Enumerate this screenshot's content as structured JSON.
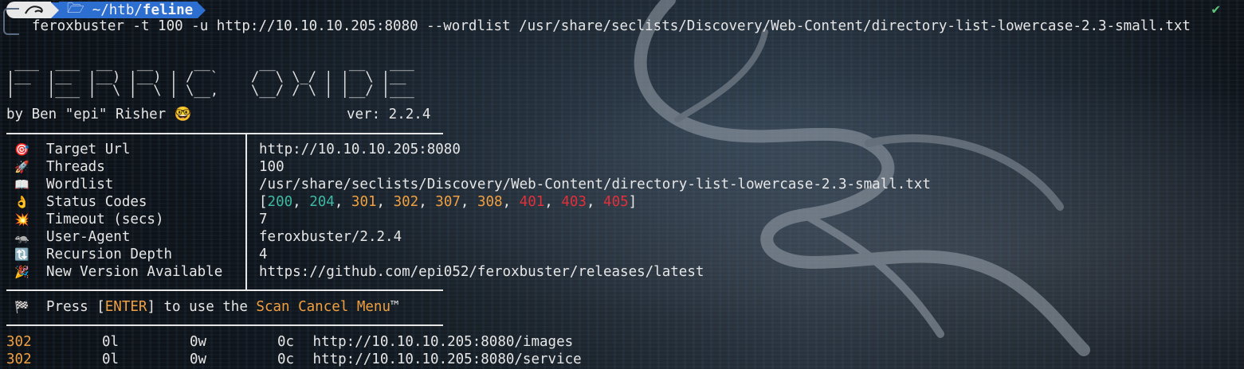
{
  "prompt": {
    "user_icon": "kali-dragon-icon",
    "path_prefix": "~/htb/",
    "path_dir": "feline",
    "status_icon": "check-icon",
    "status_symbol": "✔"
  },
  "command": "feroxbuster -t 100 -u http://10.10.10.205:8080 --wordlist /usr/share/seclists/Discovery/Web-Content/directory-list-lowercase-2.3-small.txt",
  "banner": {
    "logo_art": " ___  ___  __   __     __      __         __   ___\n|__  |__  |__) |__) | /  `    /  \\ \\_/ | |  \\ |__\n|    |___ |  \\ |  \\ | \\__,    \\__/ / \\ | |__/ |___",
    "author": "by Ben \"epi\" Risher 🤓",
    "version": "ver: 2.2.4"
  },
  "config": [
    {
      "icon": "🎯",
      "icon_name": "target-icon",
      "key": "Target Url",
      "value": "http://10.10.10.205:8080"
    },
    {
      "icon": "🚀",
      "icon_name": "rocket-icon",
      "key": "Threads",
      "value": "100"
    },
    {
      "icon": "📖",
      "icon_name": "book-icon",
      "key": "Wordlist",
      "value": "/usr/share/seclists/Discovery/Web-Content/directory-list-lowercase-2.3-small.txt"
    },
    {
      "icon": "👌",
      "icon_name": "ok-hand-icon",
      "key": "Status Codes",
      "value": ""
    },
    {
      "icon": "💥",
      "icon_name": "collision-icon",
      "key": "Timeout (secs)",
      "value": "7"
    },
    {
      "icon": "🦡",
      "icon_name": "badger-icon",
      "key": "User-Agent",
      "value": "feroxbuster/2.2.4"
    },
    {
      "icon": "🔃",
      "icon_name": "recursion-icon",
      "key": "Recursion Depth",
      "value": "4"
    },
    {
      "icon": "🎉",
      "icon_name": "party-popper-icon",
      "key": "New Version Available",
      "value": "https://github.com/epi052/feroxbuster/releases/latest"
    }
  ],
  "status_codes": [
    {
      "code": "200",
      "color": "#3fb9a3"
    },
    {
      "code": "204",
      "color": "#3fb9a3"
    },
    {
      "code": "301",
      "color": "#f0a040"
    },
    {
      "code": "302",
      "color": "#f0a040"
    },
    {
      "code": "307",
      "color": "#f0a040"
    },
    {
      "code": "308",
      "color": "#f0a040"
    },
    {
      "code": "401",
      "color": "#e0303a"
    },
    {
      "code": "403",
      "color": "#e0303a"
    },
    {
      "code": "405",
      "color": "#e0303a"
    }
  ],
  "cancel_menu": {
    "icon": "🏁",
    "icon_name": "checkered-flag-icon",
    "text_before": "Press [",
    "key": "ENTER",
    "text_middle": "] to use the ",
    "menu_name": "Scan Cancel Menu",
    "trademark": "™"
  },
  "results": [
    {
      "status": "302",
      "lines": "0l",
      "words": "0w",
      "chars": "0c",
      "url": "http://10.10.10.205:8080/images"
    },
    {
      "status": "302",
      "lines": "0l",
      "words": "0w",
      "chars": "0c",
      "url": "http://10.10.10.205:8080/service"
    }
  ],
  "colors": {
    "accent_blue": "#2d6fd0",
    "status_green": "#3fb9a3",
    "status_orange": "#f0a040",
    "status_red": "#e0303a"
  }
}
